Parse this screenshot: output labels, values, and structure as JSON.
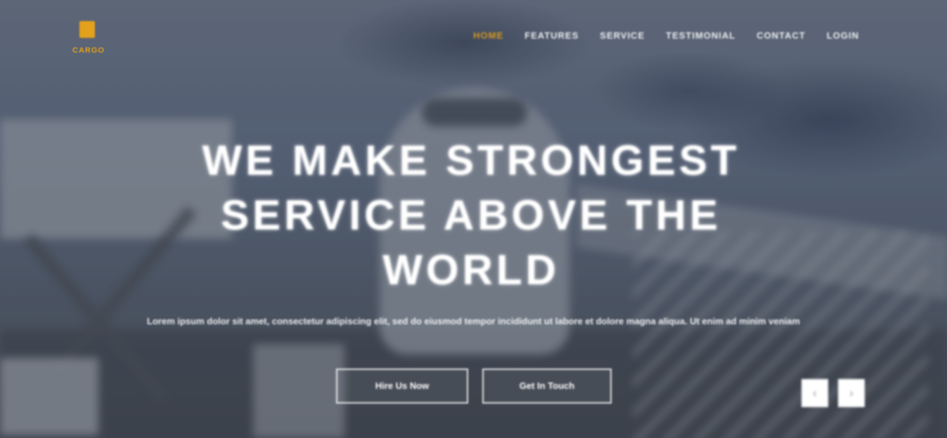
{
  "brand": {
    "logo_icon": "brand-logo-icon",
    "name": "CARGO",
    "accent_color": "#e4a11b"
  },
  "nav": {
    "items": [
      {
        "label": "HOME",
        "active": true
      },
      {
        "label": "FEATURES",
        "active": false
      },
      {
        "label": "SERVICE",
        "active": false
      },
      {
        "label": "TESTIMONIAL",
        "active": false
      },
      {
        "label": "CONTACT",
        "active": false
      },
      {
        "label": "LOGIN",
        "active": false
      }
    ]
  },
  "hero": {
    "headline_line1": "WE MAKE STRONGEST",
    "headline_line2": "SERVICE ABOVE THE",
    "headline_line3": "WORLD",
    "subtext": "Lorem ipsum dolor sit amet, consectetur adipiscing elit, sed do eiusmod tempor incididunt ut labore et dolore magna aliqua. Ut enim ad minim veniam",
    "primary_button": "Hire Us Now",
    "secondary_button": "Get In Touch"
  },
  "slider": {
    "prev_icon": "chevron-left-icon",
    "next_icon": "chevron-right-icon",
    "prev_glyph": "‹",
    "next_glyph": "›"
  }
}
